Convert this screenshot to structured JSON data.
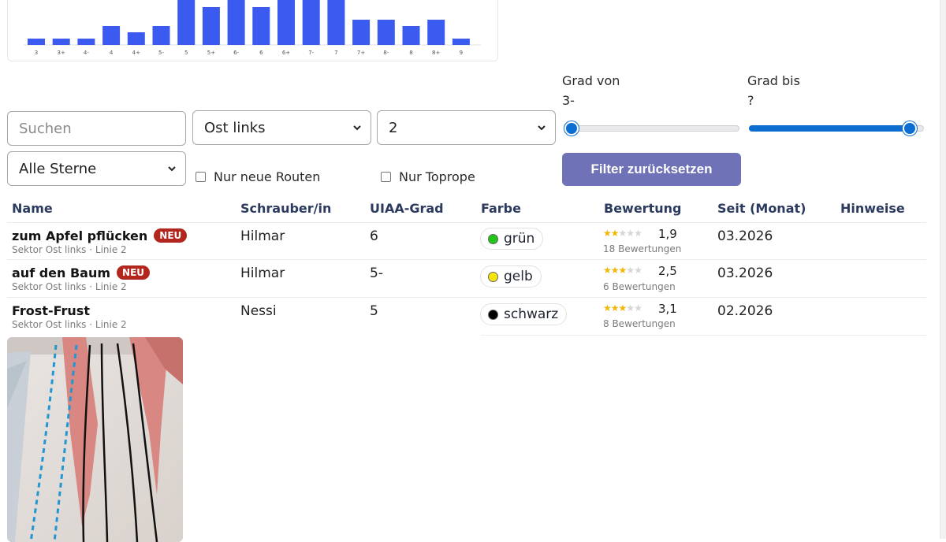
{
  "chart_data": {
    "type": "bar",
    "categories": [
      "3",
      "3+",
      "4-",
      "4",
      "4+",
      "5-",
      "5",
      "5+",
      "6-",
      "6",
      "6+",
      "7-",
      "7",
      "7+",
      "8-",
      "8",
      "8+",
      "9"
    ],
    "values": [
      1,
      1,
      1,
      3,
      2,
      3,
      8,
      6,
      8,
      6,
      9,
      9,
      8,
      4,
      4,
      3,
      4,
      1
    ],
    "title": "",
    "xlabel": "",
    "ylabel": "",
    "bar_color": "#3b5bf0"
  },
  "filters": {
    "search_placeholder": "Suchen",
    "sector_value": "Ost links",
    "line_value": "2",
    "stars_value": "Alle Sterne",
    "only_new_label": "Nur neue Routen",
    "toprope_label": "Nur Toprope",
    "grade_from_label": "Grad von",
    "grade_from_value": "3-",
    "grade_to_label": "Grad bis",
    "grade_to_value": "?",
    "grade_from_fraction": 0.04,
    "grade_to_fraction": 0.92,
    "reset_label": "Filter zurücksetzen",
    "accent": "#0d6ed1"
  },
  "table": {
    "headers": {
      "name": "Name",
      "setter": "Schrauber/in",
      "grade": "UIAA-Grad",
      "color": "Farbe",
      "rating": "Bewertung",
      "since": "Seit (Monat)",
      "notes": "Hinweise"
    },
    "rows": [
      {
        "name": "zum Apfel pflücken",
        "badge": "NEU",
        "location": "Sektor Ost links · Linie 2",
        "setter": "Hilmar",
        "grade": "6",
        "color_name": "grün",
        "color_hex": "#22c41a",
        "stars": 1.9,
        "rating": "1,9",
        "rating_count": "18 Bewertungen",
        "since": "03.2026"
      },
      {
        "name": "auf den Baum",
        "badge": "NEU",
        "location": "Sektor Ost links · Linie 2",
        "setter": "Hilmar",
        "grade": "5-",
        "color_name": "gelb",
        "color_hex": "#f5e50c",
        "stars": 2.5,
        "rating": "2,5",
        "rating_count": "6 Bewertungen",
        "since": "03.2026"
      },
      {
        "name": "Frost-Frust",
        "badge": "",
        "location": "Sektor Ost links · Linie 2",
        "setter": "Nessi",
        "grade": "5",
        "color_name": "schwarz",
        "color_hex": "#000000",
        "stars": 3.1,
        "rating": "3,1",
        "rating_count": "8 Bewertungen",
        "since": "02.2026"
      }
    ]
  }
}
